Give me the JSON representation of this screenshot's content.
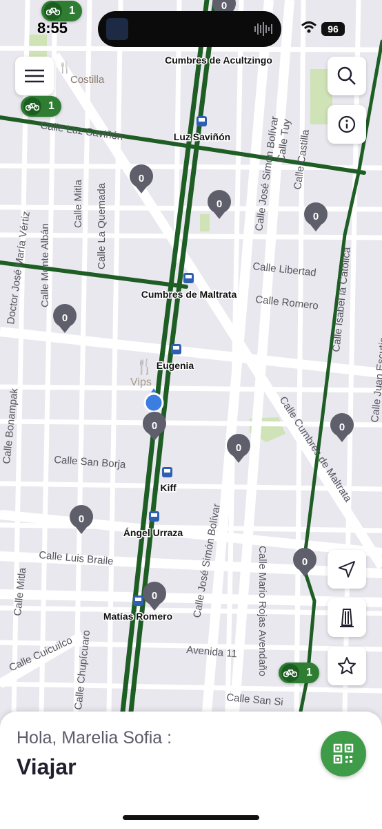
{
  "status_bar": {
    "time": "8:55",
    "battery": "96"
  },
  "map": {
    "station_labels": [
      "Cumbres de Acultzingo",
      "Luz Saviñón",
      "Cumbres de Maltrata",
      "Eugenia",
      "Kiff",
      "Ángel Urraza",
      "Matías Romero"
    ],
    "street_labels": [
      "Calle Luz Saviñón",
      "Calle Mitla",
      "Calle La Quemada",
      "Calle Monte Albán",
      "Doctor José María Vértiz",
      "Calle José Simón Bolívar",
      "Calle Tuy",
      "Calle Castilla",
      "Calle Libertad",
      "Calle Romero",
      "Calle Isabel la Católica",
      "Calle Juan Escutia",
      "Calle Cumbres de Maltrata",
      "Calle Bonampak",
      "Calle San Borja",
      "Calle Luis Braile",
      "Calle Mitla",
      "Calle José Simón Bolívar",
      "Calle Mario Rojas Avendaño",
      "Calle Cuicuilco",
      "Calle Chupícuaro",
      "Avenida 11",
      "Calle San Si"
    ],
    "poi_labels": [
      "Costilla",
      "Vips"
    ],
    "station_pin_counts": [
      "0",
      "0",
      "0",
      "0",
      "0",
      "0",
      "0",
      "0",
      "0",
      "0",
      "0",
      "0",
      "0"
    ],
    "bike_station_counts": [
      "1",
      "1",
      "1"
    ]
  },
  "bottom_sheet": {
    "greeting": "Hola, Marelia Sofia :",
    "title": "Viajar"
  },
  "colors": {
    "route_green": "#1e5e25",
    "bike_green": "#2e7d32",
    "qr_green": "#3e9b47",
    "user_location": "#3b7de0"
  }
}
